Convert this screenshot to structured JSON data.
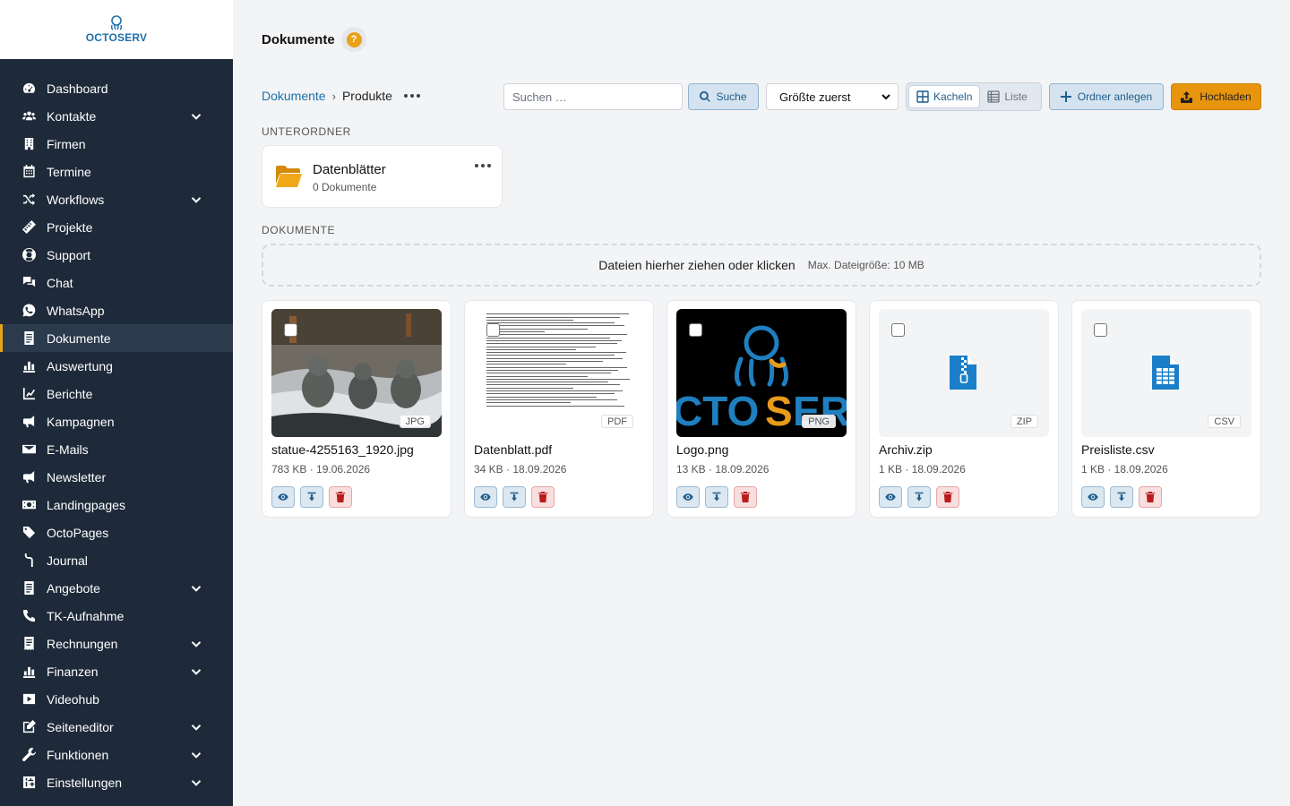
{
  "brand": {
    "name_start": "OCTO",
    "name_end": "SERV"
  },
  "sidebar": {
    "items": [
      {
        "label": "Dashboard",
        "icon": "dashboard-icon",
        "has_submenu": false
      },
      {
        "label": "Kontakte",
        "icon": "contacts-icon",
        "has_submenu": true
      },
      {
        "label": "Firmen",
        "icon": "building-icon",
        "has_submenu": false
      },
      {
        "label": "Termine",
        "icon": "calendar-icon",
        "has_submenu": false
      },
      {
        "label": "Workflows",
        "icon": "shuffle-icon",
        "has_submenu": true
      },
      {
        "label": "Projekte",
        "icon": "ruler-icon",
        "has_submenu": false
      },
      {
        "label": "Support",
        "icon": "lifebuoy-icon",
        "has_submenu": false
      },
      {
        "label": "Chat",
        "icon": "chat-icon",
        "has_submenu": false
      },
      {
        "label": "WhatsApp",
        "icon": "whatsapp-icon",
        "has_submenu": false
      },
      {
        "label": "Dokumente",
        "icon": "document-icon",
        "has_submenu": false,
        "active": true
      },
      {
        "label": "Auswertung",
        "icon": "bar-chart-icon",
        "has_submenu": false
      },
      {
        "label": "Berichte",
        "icon": "line-chart-icon",
        "has_submenu": false
      },
      {
        "label": "Kampagnen",
        "icon": "megaphone-icon",
        "has_submenu": false
      },
      {
        "label": "E-Mails",
        "icon": "envelope-icon",
        "has_submenu": false
      },
      {
        "label": "Newsletter",
        "icon": "megaphone-icon",
        "has_submenu": false
      },
      {
        "label": "Landingpages",
        "icon": "money-bill-icon",
        "has_submenu": false
      },
      {
        "label": "OctoPages",
        "icon": "tag-icon",
        "has_submenu": false
      },
      {
        "label": "Journal",
        "icon": "journal-icon",
        "has_submenu": false
      },
      {
        "label": "Angebote",
        "icon": "document-icon",
        "has_submenu": true
      },
      {
        "label": "TK-Aufnahme",
        "icon": "phone-icon",
        "has_submenu": false
      },
      {
        "label": "Rechnungen",
        "icon": "invoice-icon",
        "has_submenu": true
      },
      {
        "label": "Finanzen",
        "icon": "bar-chart-icon",
        "has_submenu": true
      },
      {
        "label": "Videohub",
        "icon": "video-icon",
        "has_submenu": false
      },
      {
        "label": "Seiteneditor",
        "icon": "edit-icon",
        "has_submenu": true
      },
      {
        "label": "Funktionen",
        "icon": "wrench-icon",
        "has_submenu": true
      },
      {
        "label": "Einstellungen",
        "icon": "settings-icon",
        "has_submenu": true
      }
    ]
  },
  "header": {
    "title": "Dokumente",
    "help": "?"
  },
  "breadcrumb": {
    "root": "Dokumente",
    "separator": "›",
    "current": "Produkte"
  },
  "toolbar": {
    "search_placeholder": "Suchen …",
    "search_label": "Suche",
    "sort_value": "Größte zuerst",
    "view_tiles": "Kacheln",
    "view_list": "Liste",
    "new_folder": "Ordner anlegen",
    "upload": "Hochladen"
  },
  "subfolders": {
    "heading": "UNTERORDNER",
    "items": [
      {
        "name": "Datenblätter",
        "count": "0 Dokumente"
      }
    ]
  },
  "documents": {
    "heading": "DOKUMENTE",
    "dropzone_text": "Dateien hierher ziehen oder klicken",
    "dropzone_limit": "Max. Dateigröße: 10 MB",
    "items": [
      {
        "name": "statue-4255163_1920.jpg",
        "meta": "783 KB · 19.06.2026",
        "ext": "JPG",
        "thumb": "photo"
      },
      {
        "name": "Datenblatt.pdf",
        "meta": "34 KB · 18.09.2026",
        "ext": "PDF",
        "thumb": "document"
      },
      {
        "name": "Logo.png",
        "meta": "13 KB · 18.09.2026",
        "ext": "PNG",
        "thumb": "logo"
      },
      {
        "name": "Archiv.zip",
        "meta": "1 KB · 18.09.2026",
        "ext": "ZIP",
        "thumb": "zip-file-icon"
      },
      {
        "name": "Preisliste.csv",
        "meta": "1 KB · 18.09.2026",
        "ext": "CSV",
        "thumb": "csv-file-icon"
      }
    ]
  },
  "colors": {
    "sidebar_bg": "#1e2a3a",
    "accent": "#e8a21a",
    "link": "#1f6fa8",
    "file_icon": "#1a7fc8"
  }
}
